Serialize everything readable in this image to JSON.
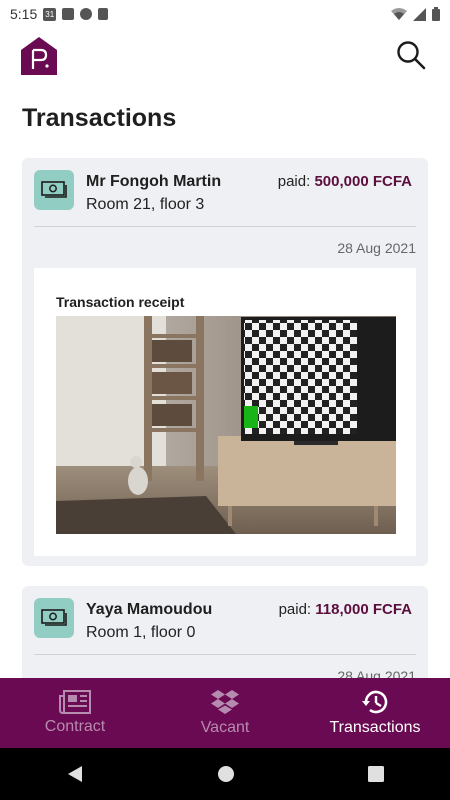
{
  "status_bar": {
    "time": "5:15",
    "calendar_day": "31"
  },
  "header": {
    "title": "Transactions"
  },
  "transactions": [
    {
      "name": "Mr Fongoh Martin",
      "room": "Room 21, floor 3",
      "paid_label": "paid:",
      "amount": "500,000 FCFA",
      "date": "28 Aug 2021",
      "receipt_title": "Transaction receipt"
    },
    {
      "name": "Yaya Mamoudou",
      "room": "Room 1, floor 0",
      "paid_label": "paid:",
      "amount": "118,000 FCFA",
      "date": "28 Aug 2021"
    }
  ],
  "bottom_nav": {
    "items": [
      {
        "label": "Contract",
        "icon": "newspaper-icon",
        "active": false
      },
      {
        "label": "Vacant",
        "icon": "dropbox-icon",
        "active": false
      },
      {
        "label": "Transactions",
        "icon": "history-icon",
        "active": true
      }
    ]
  },
  "colors": {
    "brand": "#6a0a52",
    "amount": "#5c0e3d",
    "badge": "#91cdc3",
    "card": "#eef0f3"
  }
}
